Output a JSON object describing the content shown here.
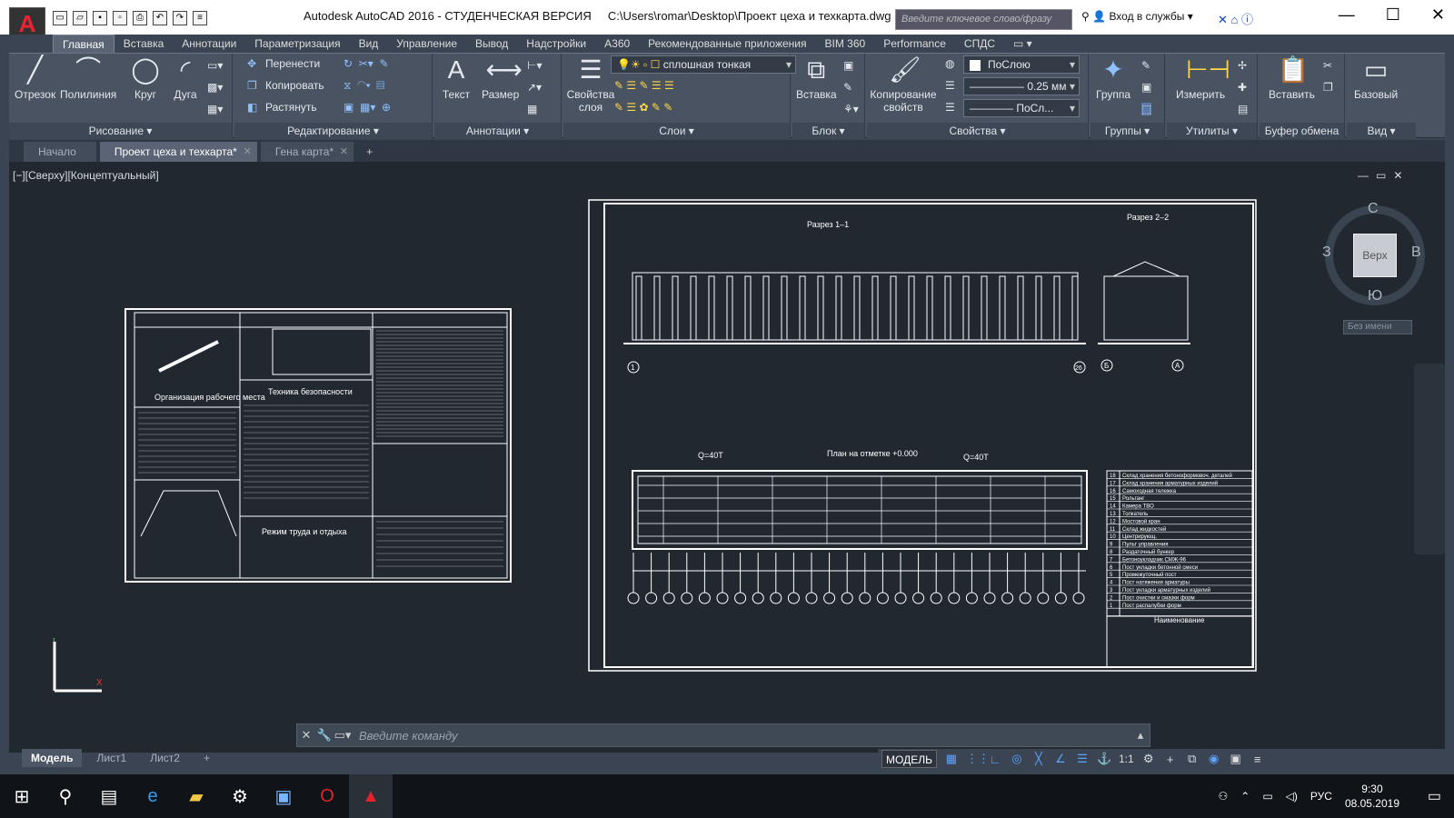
{
  "window": {
    "title": "Autodesk AutoCAD 2016 - СТУДЕНЧЕСКАЯ ВЕРСИЯ",
    "filepath": "C:\\Users\\romar\\Desktop\\Проект цеха и техкарта.dwg",
    "search_placeholder": "Введите ключевое слово/фразу",
    "login": "Вход в службы",
    "logo": "A"
  },
  "ribbon_tabs": [
    "Главная",
    "Вставка",
    "Аннотации",
    "Параметризация",
    "Вид",
    "Управление",
    "Вывод",
    "Надстройки",
    "A360",
    "Рекомендованные приложения",
    "BIM 360",
    "Performance",
    "СПДС"
  ],
  "ribbon": {
    "draw": {
      "label": "Рисование",
      "tools": [
        "Отрезок",
        "Полилиния",
        "Круг",
        "Дуга"
      ]
    },
    "modify": {
      "label": "Редактирование",
      "tools": [
        "Перенести",
        "Копировать",
        "Растянуть"
      ]
    },
    "annotation": {
      "label": "Аннотации",
      "tools": [
        "Текст",
        "Размер"
      ]
    },
    "layers": {
      "label": "Слои",
      "tool": "Свойства слоя",
      "combo": "сплошная тонкая"
    },
    "block": {
      "label": "Блок",
      "tool": "Вставка"
    },
    "properties": {
      "label": "Свойства",
      "tool": "Копирование свойств",
      "color": "ПоСлою",
      "lineweight": "0.25 мм",
      "linetype": "ПоСл..."
    },
    "groups": {
      "label": "Группы",
      "tool": "Группа"
    },
    "utilities": {
      "label": "Утилиты",
      "tool": "Измерить"
    },
    "clipboard": {
      "label": "Буфер обмена",
      "tool": "Вставить"
    },
    "view": {
      "label": "Вид",
      "tool": "Базовый"
    }
  },
  "doc_tabs": [
    {
      "label": "Начало",
      "active": false
    },
    {
      "label": "Проект цеха и техкарта*",
      "active": true
    },
    {
      "label": "Гена карта*",
      "active": false
    }
  ],
  "viewport": {
    "label": "[−][Сверху][Концептуальный]",
    "viewcube": {
      "top": "Верх",
      "n": "С",
      "s": "Ю",
      "w": "З",
      "e": "В"
    },
    "named_view": "Без имени"
  },
  "drawing": {
    "left_sheet": {
      "title1": "Организация рабочего места",
      "title2": "Техника безопасности",
      "title3": "Режим труда и отдыха"
    },
    "right_sheet": {
      "section1": "Разрез 1–1",
      "section2": "Разрез 2–2",
      "plan": "План на отметке +0.000",
      "crane1": "Q=40T",
      "crane2": "Q=40T",
      "legend_header": "Наименование",
      "legend": [
        {
          "n": "18",
          "t": "Склад хранения бетоноформовоч. деталей"
        },
        {
          "n": "17",
          "t": "Склад хранения арматурных изделий"
        },
        {
          "n": "16",
          "t": "Самоходная тележка"
        },
        {
          "n": "15",
          "t": "Рольганг"
        },
        {
          "n": "14",
          "t": "Камера ТВО"
        },
        {
          "n": "13",
          "t": "Толкатель"
        },
        {
          "n": "12",
          "t": "Мостовой кран"
        },
        {
          "n": "11",
          "t": "Склад жидкостей"
        },
        {
          "n": "10",
          "t": "Центрирующ."
        },
        {
          "n": "9",
          "t": "Пульт управления"
        },
        {
          "n": "8",
          "t": "Раздаточный бункер"
        },
        {
          "n": "7",
          "t": "Бетоноукладчик СМЖ-96"
        },
        {
          "n": "6",
          "t": "Пост укладки бетонной смеси"
        },
        {
          "n": "5",
          "t": "Промежуточный пост"
        },
        {
          "n": "4",
          "t": "Пост натяжения арматуры"
        },
        {
          "n": "3",
          "t": "Пост укладки арматурных изделий"
        },
        {
          "n": "2",
          "t": "Пост очистки и смазки форм"
        },
        {
          "n": "1",
          "t": "Пост распалубки форм"
        }
      ],
      "axis_left": "1",
      "axis_right": "26",
      "axis_b": "Б",
      "axis_a": "А"
    }
  },
  "command": {
    "placeholder": "Введите команду"
  },
  "layout_tabs": [
    "Модель",
    "Лист1",
    "Лист2"
  ],
  "status": {
    "model": "МОДЕЛЬ",
    "scale": "1:1"
  },
  "taskbar": {
    "lang": "РУС",
    "time": "9:30",
    "date": "08.05.2019"
  }
}
